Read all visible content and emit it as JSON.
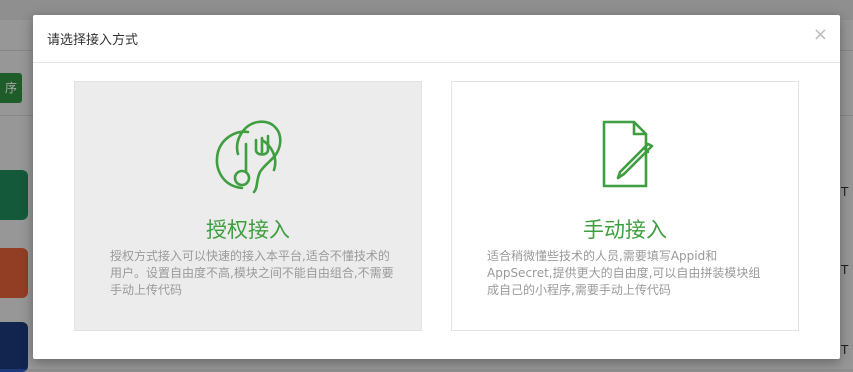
{
  "modal": {
    "title": "请选择接入方式",
    "close_symbol": "×"
  },
  "options": [
    {
      "title": "授权接入",
      "description": "授权方式接入可以快速的接入本平台,适合不懂技术的用户。设置自由度不高,模块之间不能自由组合,不需要手动上传代码",
      "icon": "authorize-plug-icon",
      "selected": true
    },
    {
      "title": "手动接入",
      "description": "适合稍微懂些技术的人员,需要填写Appid和AppSecret,提供更大的自由度,可以自由拼装模块组成自己的小程序,需要手动上传代码",
      "icon": "document-edit-icon",
      "selected": false
    }
  ],
  "background": {
    "button_label": "序",
    "right_labels": [
      "T",
      "T",
      "T"
    ]
  },
  "colors": {
    "accent": "#3f9e3f",
    "selected_card_bg": "#ececec"
  }
}
